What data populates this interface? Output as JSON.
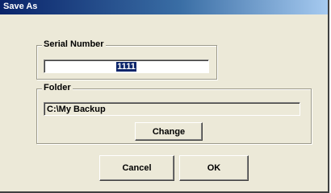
{
  "window": {
    "title": "Save As"
  },
  "serial_number": {
    "label": "Serial Number",
    "value": "1111"
  },
  "folder": {
    "label": "Folder",
    "path": "C:\\My Backup",
    "change_label": "Change"
  },
  "buttons": {
    "cancel_label": "Cancel",
    "ok_label": "OK"
  }
}
